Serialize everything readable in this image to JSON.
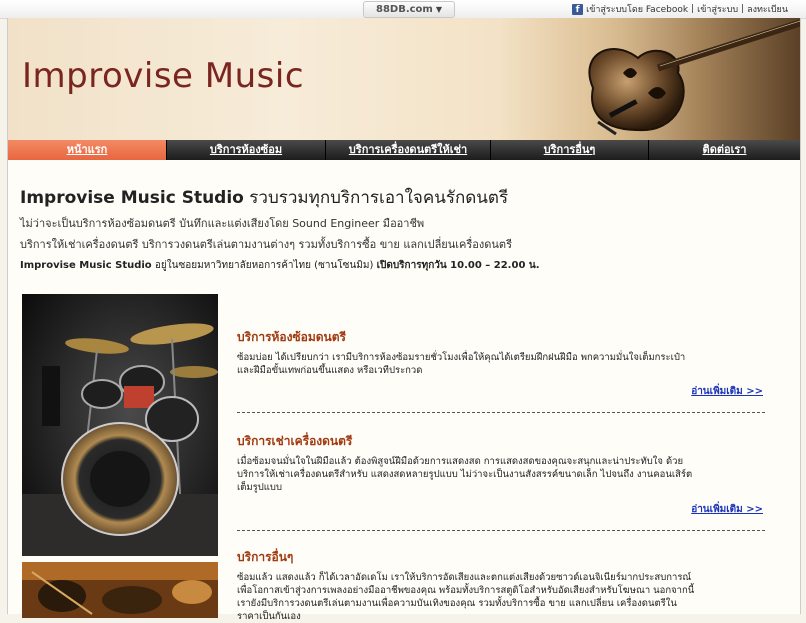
{
  "topbar": {
    "brand": "88DB.com",
    "facebook_login": "เข้าสู่ระบบโดย Facebook",
    "separator": "|",
    "login": "เข้าสู่ระบบ",
    "register": "ลงทะเบียน"
  },
  "header": {
    "site_title": "Improvise Music"
  },
  "nav": {
    "items": [
      {
        "label": "หน้าแรก"
      },
      {
        "label": "บริการห้องซ้อม"
      },
      {
        "label": "บริการเครื่องดนตรีให้เช่า"
      },
      {
        "label": "บริการอื่นๆ"
      },
      {
        "label": "ติดต่อเรา"
      }
    ]
  },
  "intro": {
    "title_bold": "Improvise Music Studio",
    "title_rest": " รวบรวมทุกบริการเอาใจคนรักดนตรี",
    "line1": "ไม่ว่าจะเป็นบริการห้องซ้อมดนตรี บันทึกและแต่งเสียงโดย Sound Engineer มืออาชีพ",
    "line2": "บริการให้เช่าเครื่องดนตรี บริการวงดนตรีเล่นตามงานต่างๆ รวมทั้งบริการซื้อ ขาย แลกเปลี่ยนเครื่องดนตรี",
    "hours_name": "Improvise Music Studio",
    "hours_location": " อยู่ในซอยมหาวิทยาลัยหอการค้าไทย (ซานโซนมิม) ",
    "hours_time": "เปิดบริการทุกวัน 10.00 – 22.00 น."
  },
  "services": [
    {
      "title": "บริการห้องซ้อมดนตรี",
      "desc": "ซ้อมบ่อย ได้เปรียบกว่า เรามีบริการห้องซ้อมรายชั่วโมงเพื่อให้คุณได้เตรียมฝึกฝนฝีมือ พกความมั่นใจเต็มกระเป๋า และฝีมือขั้นเทพก่อนขึ้นแสดง หรือเวทีประกวด",
      "read_more": "อ่านเพิ่มเติม >>"
    },
    {
      "title": "บริการเช่าเครื่องดนตรี",
      "desc": "เมื่อซ้อมจนมั่นใจในฝีมือแล้ว ต้องพิสูจน์ฝีมือด้วยการแสดงสด การแสดงสดของคุณจะสนุกและน่าประทับใจ ด้วยบริการให้เช่าเครื่องดนตรีสำหรับ แสดงสดหลายรูปแบบ ไม่ว่าจะเป็นงานสังสรรค์ขนาดเล็ก ไปจนถึง งานคอนเสิร์ตเต็มรูปแบบ",
      "read_more": "อ่านเพิ่มเติม >>"
    },
    {
      "title": "บริการอื่นๆ",
      "desc": "ซ้อมแล้ว แสดงแล้ว ก็ได้เวลาอัดเดโม เราให้บริการอัดเสียงและตกแต่งเสียงด้วยซาวด์เอนจิเนียร์มากประสบการณ์ เพื่อโอกาสเข้าสู่วงการเพลงอย่างมืออาชีพของคุณ พร้อมทั้งบริการสตูดิโอสำหรับอัดเสียงสำหรับโฆษณา นอกจากนี้เรายังมีบริการวงดนตรีเล่นตามงานเพื่อความบันเทิงของคุณ รวมทั้งบริการซื้อ ขาย แลกเปลี่ยน เครื่องดนตรีในราคาเป็นกันเอง"
    }
  ],
  "colors": {
    "nav_active": "#e8663f",
    "nav_bg": "#1c1c1c",
    "title": "#7a2520",
    "service_title": "#a03a10",
    "link": "#1a33b8"
  }
}
